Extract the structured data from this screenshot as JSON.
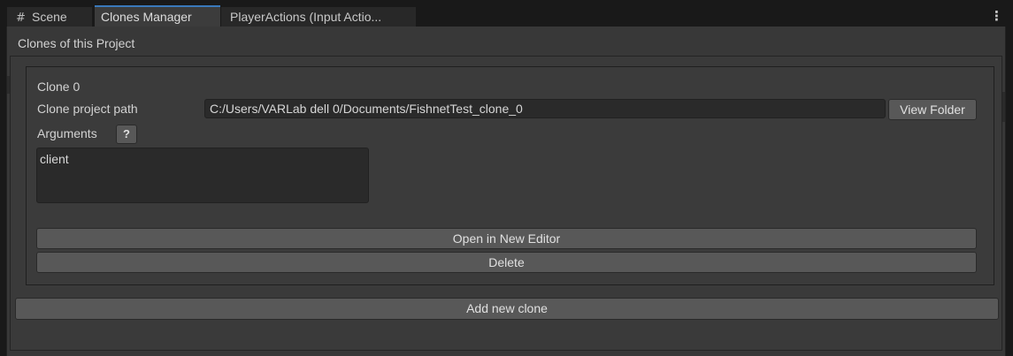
{
  "tabs": {
    "scene": {
      "label": "Scene",
      "icon": "grid-icon"
    },
    "clones_manager": {
      "label": "Clones Manager",
      "active": true
    },
    "player_actions": {
      "label": "PlayerActions (Input Actio..."
    }
  },
  "window": {
    "section_title": "Clones of this Project",
    "clone": {
      "name": "Clone 0",
      "path_label": "Clone project path",
      "path_value": "C:/Users/VARLab dell 0/Documents/FishnetTest_clone_0",
      "view_folder_label": "View Folder",
      "arguments_label": "Arguments",
      "help_label": "?",
      "arguments_value": "client",
      "open_label": "Open in New Editor",
      "delete_label": "Delete"
    },
    "add_clone_label": "Add new clone"
  },
  "colors": {
    "active_tab_accent": "#3a79bb",
    "panel_bg": "#383838",
    "button_bg": "#585858",
    "field_bg": "#2a2a2a"
  }
}
